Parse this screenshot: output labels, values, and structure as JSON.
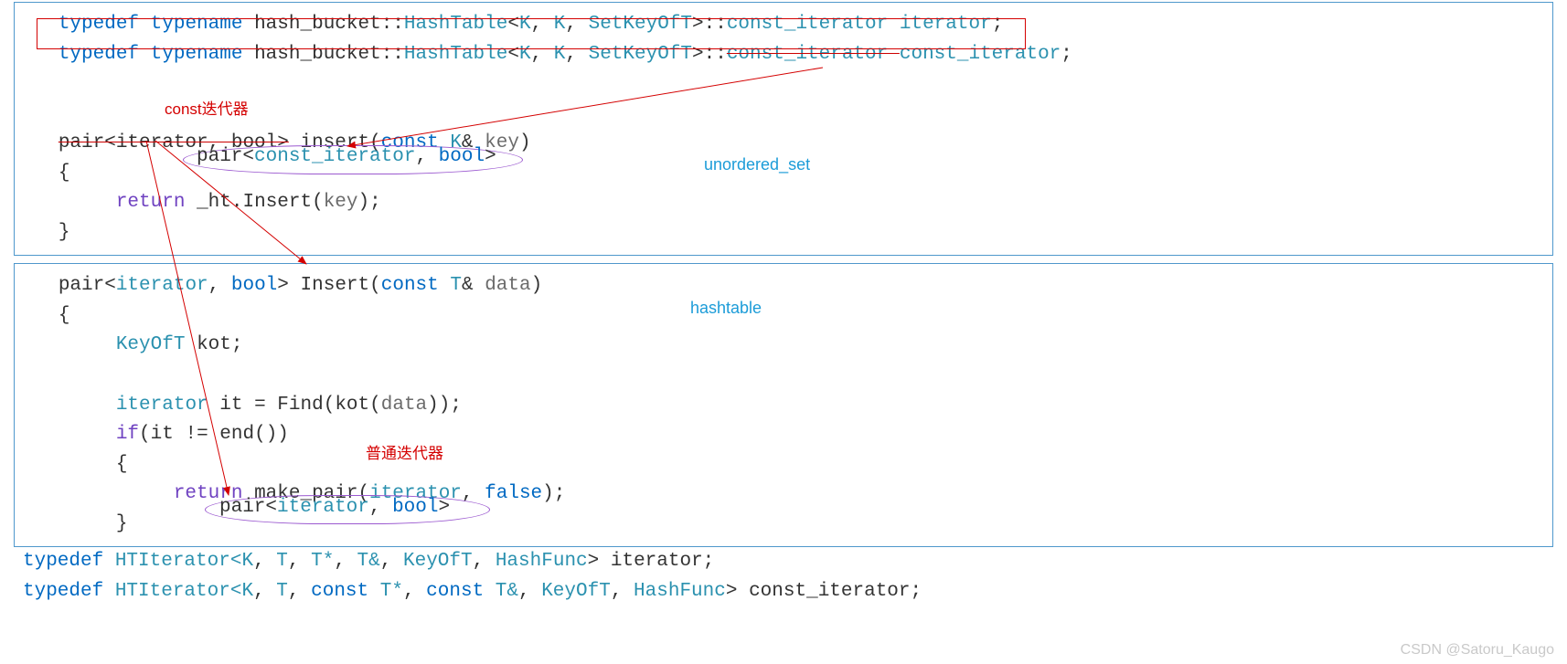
{
  "box1": {
    "line1": {
      "kw1": "typedef",
      "kw2": "typename",
      "ns": "hash_bucket::",
      "tpl": "HashTable",
      "lt": "<",
      "p1": "K",
      "c1": ", ",
      "p2": "K",
      "c2": ", ",
      "p3": "SetKeyOfT",
      "gt": ">::",
      "ci": "const_iterator ",
      "it": "iterator",
      "semi": ";"
    },
    "line2": {
      "kw1": "typedef",
      "kw2": "typename",
      "ns": "hash_bucket::",
      "tpl": "HashTable",
      "lt": "<",
      "p1": "K",
      "c1": ", ",
      "p2": "K",
      "c2": ", ",
      "p3": "SetKeyOfT",
      "gt": ">::",
      "ci": "const_iterator ",
      "cit": "const_iterator",
      "semi": ";"
    },
    "line3": {
      "sig": "pair<iterator, bool>",
      "fn": " insert(",
      "kwconst": "const",
      "sp": " ",
      "t": "K",
      "amp": "& ",
      "arg": "key",
      "close": ")"
    },
    "line4": {
      "brace": "{"
    },
    "line5": {
      "kwret": "return",
      "sp": " ",
      "ht": "_ht",
      "dot": ".",
      "insert": "Insert(",
      "arg": "key",
      "close": ");"
    },
    "line6": {
      "brace": "}"
    },
    "bubble1_pre": "pair<",
    "bubble1_ci": "const_iterator",
    "bubble1_comma": ",",
    "bubble1_bool": " bool",
    "bubble1_gt": ">"
  },
  "box2": {
    "line1": {
      "pre": "pair<",
      "it": "iterator",
      "mid": ", ",
      "bl": "bool",
      "gt": "> ",
      "fn": "Insert(",
      "kwconst": "const",
      "sp": " ",
      "t": "T",
      "amp": "& ",
      "arg": "data",
      "close": ")"
    },
    "line2": {
      "brace": "{"
    },
    "line3": {
      "type": "KeyOfT",
      "sp": " ",
      "var": "kot",
      "semi": ";"
    },
    "line4": {
      "type": "iterator",
      "sp": " ",
      "var": "it",
      "eq": " = ",
      "fn": "Find(",
      "call": "kot(",
      "arg": "data",
      "close": "));"
    },
    "line5": {
      "kwif": "if",
      "open": "(",
      "var": "it",
      "neq": " != ",
      "end": "end())"
    },
    "line6": {
      "brace": "{"
    },
    "line7": {
      "kwret": "return",
      "sp": " ",
      "mp": "make_pair(",
      "it": "iterator",
      "comma": ", ",
      "f": "false",
      "close": ");"
    },
    "line8": {
      "brace": "}"
    },
    "bubble2_pre": "pair<",
    "bubble2_it": "iterator",
    "bubble2_mid": ", ",
    "bubble2_bl": "bool",
    "bubble2_gt": ">"
  },
  "bottom": {
    "l1": {
      "kw": "typedef",
      "tpl": " HTIterator<",
      "p1": "K",
      "c": ", ",
      "p2": "T",
      "p3": "T*",
      "p4": "T&",
      "p5": "KeyOfT",
      "p6": "HashFunc",
      "end": "> iterator;"
    },
    "l2": {
      "kw": "typedef",
      "tpl": " HTIterator<",
      "p1": "K",
      "c": ", ",
      "p2": "T",
      "kwconst": "const",
      "p3": " T*",
      "p4": " T&",
      "p5": "KeyOfT",
      "p6": "HashFunc",
      "end": "> const_iterator;"
    }
  },
  "annot": {
    "const_iter": "const迭代器",
    "unordered_set": "unordered_set",
    "hashtable": "hashtable",
    "normal_iter": "普通迭代器",
    "watermark": "CSDN @Satoru_Kaugo"
  }
}
